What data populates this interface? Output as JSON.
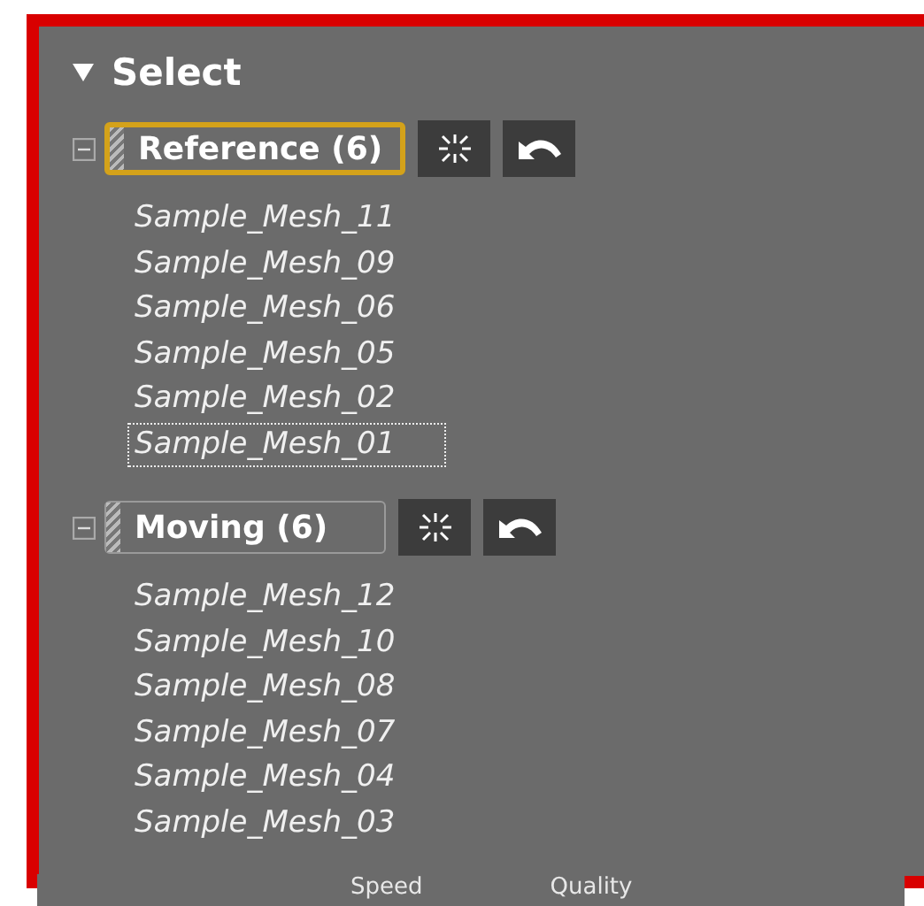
{
  "section": {
    "title": "Select",
    "expanded": true
  },
  "groups": [
    {
      "label": "Reference (6)",
      "selected": true,
      "expanded": true,
      "items": [
        {
          "name": "Sample_Mesh_11",
          "focused": false
        },
        {
          "name": "Sample_Mesh_09",
          "focused": false
        },
        {
          "name": "Sample_Mesh_06",
          "focused": false
        },
        {
          "name": "Sample_Mesh_05",
          "focused": false
        },
        {
          "name": "Sample_Mesh_02",
          "focused": false
        },
        {
          "name": "Sample_Mesh_01",
          "focused": true
        }
      ]
    },
    {
      "label": "Moving (6)",
      "selected": false,
      "expanded": true,
      "items": [
        {
          "name": "Sample_Mesh_12",
          "focused": false
        },
        {
          "name": "Sample_Mesh_10",
          "focused": false
        },
        {
          "name": "Sample_Mesh_08",
          "focused": false
        },
        {
          "name": "Sample_Mesh_07",
          "focused": false
        },
        {
          "name": "Sample_Mesh_04",
          "focused": false
        },
        {
          "name": "Sample_Mesh_03",
          "focused": false
        }
      ]
    }
  ],
  "footer_labels": [
    "Speed",
    "Quality"
  ]
}
